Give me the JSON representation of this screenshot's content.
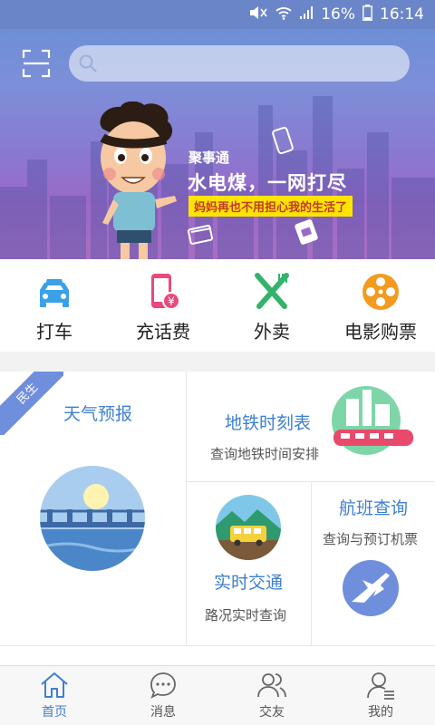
{
  "status_bar": {
    "battery": "16%",
    "time": "16:14"
  },
  "banner": {
    "brand": "聚事通",
    "title": "水电煤，一网打尽",
    "subtitle": "妈妈再也不用担心我的生活了"
  },
  "search": {
    "placeholder": ""
  },
  "quick_actions": [
    {
      "label": "打车",
      "icon": "taxi-icon",
      "color": "#3aa0e8"
    },
    {
      "label": "充话费",
      "icon": "phone-topup-icon",
      "color": "#e94a7a"
    },
    {
      "label": "外卖",
      "icon": "fork-knife-icon",
      "color": "#34b36a"
    },
    {
      "label": "电影购票",
      "icon": "film-reel-icon",
      "color": "#f39a1f"
    }
  ],
  "grid": {
    "ribbon": "民生",
    "weather": {
      "title": "天气预报"
    },
    "subway": {
      "title": "地铁时刻表",
      "subtitle": "查询地铁时间安排"
    },
    "traffic": {
      "title": "实时交通",
      "subtitle": "路况实时查询"
    },
    "flight": {
      "title": "航班查询",
      "subtitle": "查询与预订机票"
    }
  },
  "bottom_nav": [
    {
      "label": "首页",
      "icon": "home-icon",
      "active": true
    },
    {
      "label": "消息",
      "icon": "chat-icon",
      "active": false
    },
    {
      "label": "交友",
      "icon": "friends-icon",
      "active": false
    },
    {
      "label": "我的",
      "icon": "profile-icon",
      "active": false
    }
  ],
  "colors": {
    "accent": "#3f7fd0",
    "status_bar": "#6b86c8"
  }
}
